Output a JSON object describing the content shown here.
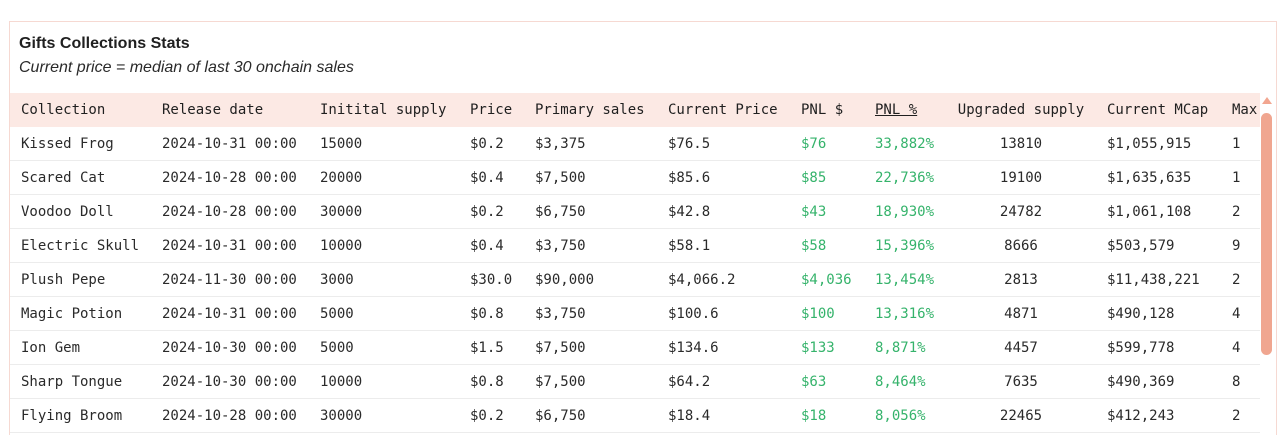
{
  "header": {
    "title": "Gifts Collections Stats",
    "subtitle": "Current price = median of last 30 onchain sales"
  },
  "table": {
    "columns": [
      "Collection",
      "Release date",
      "Initital supply",
      "Price",
      "Primary sales",
      "Current Price",
      "PNL $",
      "PNL %",
      "Upgraded supply",
      "Current MCap",
      "Max"
    ],
    "sorted_column": "PNL %",
    "rows": [
      [
        "Kissed Frog",
        "2024-10-31 00:00",
        "15000",
        "$0.2",
        "$3,375",
        "$76.5",
        "$76",
        "33,882%",
        "13810",
        "$1,055,915",
        "1"
      ],
      [
        "Scared Cat",
        "2024-10-28 00:00",
        "20000",
        "$0.4",
        "$7,500",
        "$85.6",
        "$85",
        "22,736%",
        "19100",
        "$1,635,635",
        "1"
      ],
      [
        "Voodoo Doll",
        "2024-10-28 00:00",
        "30000",
        "$0.2",
        "$6,750",
        "$42.8",
        "$43",
        "18,930%",
        "24782",
        "$1,061,108",
        "2"
      ],
      [
        "Electric Skull",
        "2024-10-31 00:00",
        "10000",
        "$0.4",
        "$3,750",
        "$58.1",
        "$58",
        "15,396%",
        "8666",
        "$503,579",
        "9"
      ],
      [
        "Plush Pepe",
        "2024-11-30 00:00",
        "3000",
        "$30.0",
        "$90,000",
        "$4,066.2",
        "$4,036",
        "13,454%",
        "2813",
        "$11,438,221",
        "2"
      ],
      [
        "Magic Potion",
        "2024-10-31 00:00",
        "5000",
        "$0.8",
        "$3,750",
        "$100.6",
        "$100",
        "13,316%",
        "4871",
        "$490,128",
        "4"
      ],
      [
        "Ion Gem",
        "2024-10-30 00:00",
        "5000",
        "$1.5",
        "$7,500",
        "$134.6",
        "$133",
        "8,871%",
        "4457",
        "$599,778",
        "4"
      ],
      [
        "Sharp Tongue",
        "2024-10-30 00:00",
        "10000",
        "$0.8",
        "$7,500",
        "$64.2",
        "$63",
        "8,464%",
        "7635",
        "$490,369",
        "8"
      ],
      [
        "Flying Broom",
        "2024-10-28 00:00",
        "30000",
        "$0.2",
        "$6,750",
        "$18.4",
        "$18",
        "8,056%",
        "22465",
        "$412,243",
        "2"
      ]
    ]
  },
  "colors": {
    "header_bg": "#fce9e4",
    "positive": "#35b36b",
    "scrollbar": "#f0a690",
    "border": "#f6d9d2"
  }
}
